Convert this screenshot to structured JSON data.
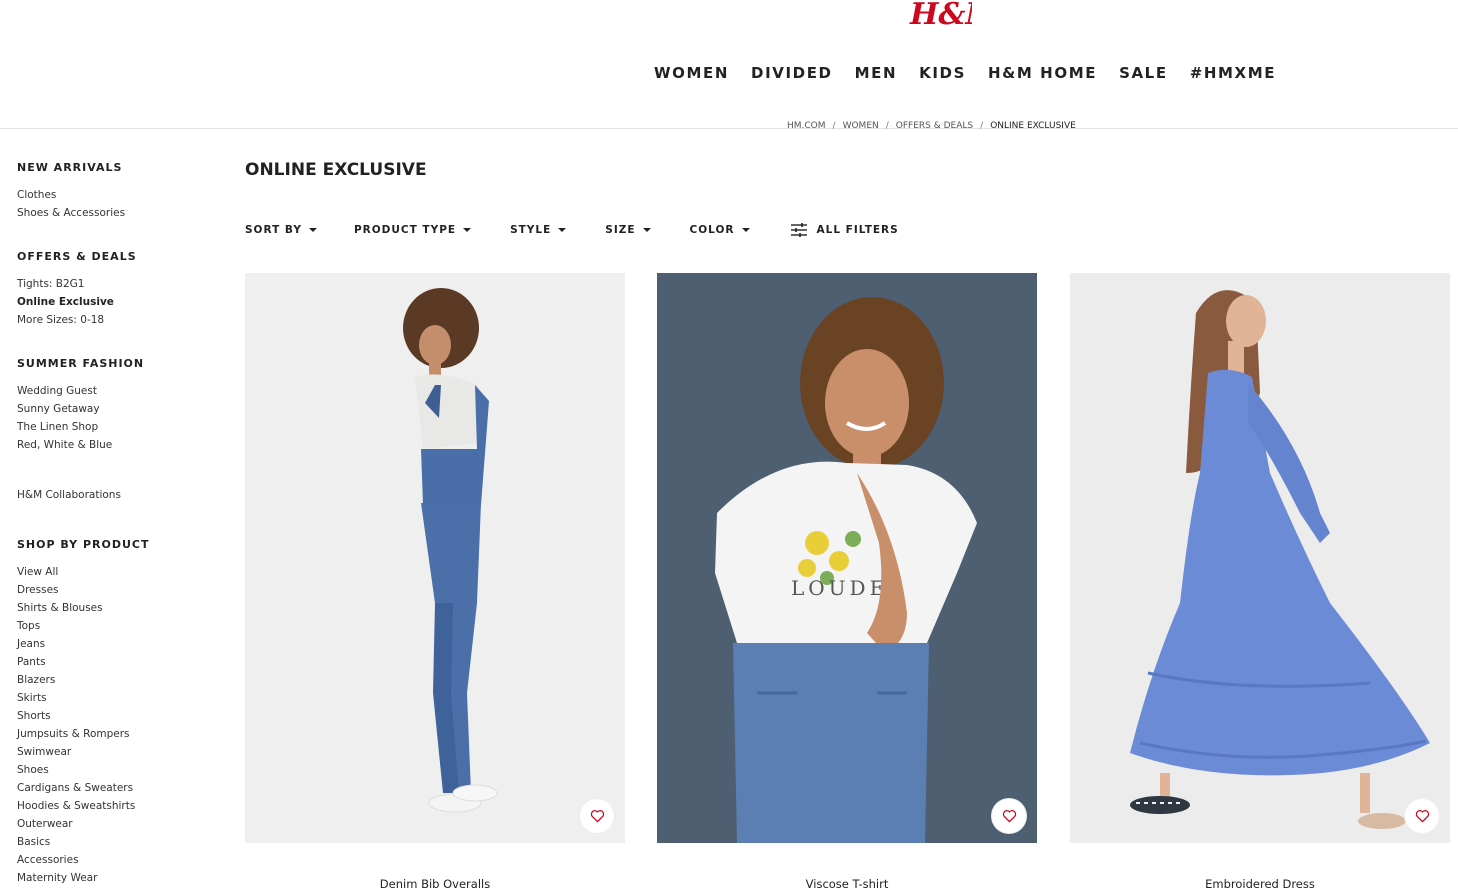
{
  "brand": {
    "logo_text": "H&M",
    "color": "#cc071e"
  },
  "nav": {
    "items": [
      "WOMEN",
      "DIVIDED",
      "MEN",
      "KIDS",
      "H&M HOME",
      "SALE",
      "#HMXME"
    ]
  },
  "breadcrumb": [
    "HM.COM",
    "WOMEN",
    "OFFERS & DEALS",
    "ONLINE EXCLUSIVE"
  ],
  "sidebar": {
    "sections": [
      {
        "heading": "NEW ARRIVALS",
        "links": [
          "Clothes",
          "Shoes & Accessories"
        ]
      },
      {
        "heading": "OFFERS & DEALS",
        "links": [
          "Tights: B2G1",
          "Online Exclusive",
          "More Sizes: 0-18"
        ],
        "active": "Online Exclusive"
      },
      {
        "heading": "SUMMER FASHION",
        "links": [
          "Wedding Guest",
          "Sunny Getaway",
          "The Linen Shop",
          "Red, White & Blue"
        ]
      },
      {
        "heading": "",
        "links": [
          "H&M Collaborations"
        ]
      },
      {
        "heading": "SHOP BY PRODUCT",
        "links": [
          "View All",
          "Dresses",
          "Shirts & Blouses",
          "Tops",
          "Jeans",
          "Pants",
          "Blazers",
          "Skirts",
          "Shorts",
          "Jumpsuits & Rompers",
          "Swimwear",
          "Shoes",
          "Cardigans & Sweaters",
          "Hoodies & Sweatshirts",
          "Outerwear",
          "Basics",
          "Accessories",
          "Maternity Wear"
        ]
      }
    ]
  },
  "main": {
    "title": "ONLINE EXCLUSIVE",
    "filters": [
      "SORT BY",
      "PRODUCT TYPE",
      "STYLE",
      "SIZE",
      "COLOR"
    ],
    "all_filters": "ALL FILTERS",
    "filter_icon": "sliders-icon"
  },
  "products": [
    {
      "title": "Denim Bib Overalls",
      "background": "#efefef",
      "icon": "heart-icon"
    },
    {
      "title": "Viscose T-shirt",
      "background": "#4d5f70",
      "icon": "heart-icon"
    },
    {
      "title": "Embroidered Dress",
      "background": "#ececec",
      "icon": "heart-icon"
    }
  ]
}
